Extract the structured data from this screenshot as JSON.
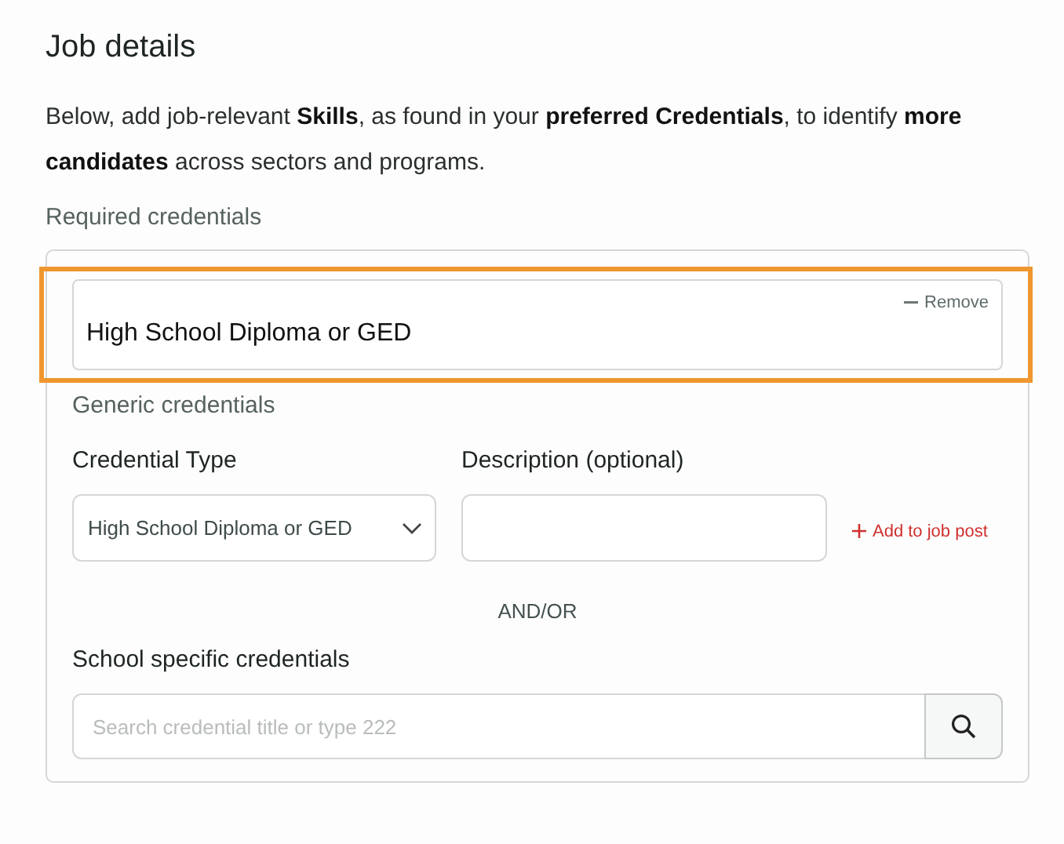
{
  "title": "Job details",
  "intro": "Below, add job-relevant **Skills**, as found in your **preferred Credentials**, to identify **more candidates** across sectors and programs.",
  "section_label": "Required credentials",
  "credentials": [
    {
      "title": "High School Diploma or GED",
      "remove_label": "Remove",
      "highlighted": true
    }
  ],
  "generic": {
    "heading": "Generic credentials",
    "type_label": "Credential Type",
    "type_value": "High School Diploma or GED",
    "description_label": "Description (optional)",
    "add_label": "Add to job post"
  },
  "separator": "AND/OR",
  "school": {
    "label": "School specific credentials",
    "placeholder": "Search credential title or type 222"
  }
}
